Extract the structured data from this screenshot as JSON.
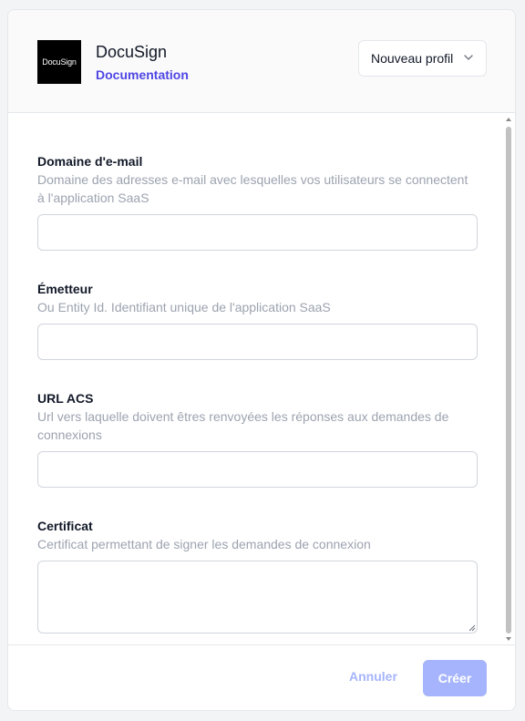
{
  "header": {
    "logo_text": "DocuSign",
    "app_name": "DocuSign",
    "doc_link": "Documentation",
    "profile_select": "Nouveau profil"
  },
  "fields": [
    {
      "label": "Domaine d'e-mail",
      "description": "Domaine des adresses e-mail avec lesquelles vos utilisateurs se connectent à l'application SaaS",
      "value": ""
    },
    {
      "label": "Émetteur",
      "description": "Ou Entity Id. Identifiant unique de l'application SaaS",
      "value": ""
    },
    {
      "label": "URL ACS",
      "description": "Url vers laquelle doivent êtres renvoyées les réponses aux demandes de connexions",
      "value": ""
    },
    {
      "label": "Certificat",
      "description": "Certificat permettant de signer les demandes de connexion",
      "value": ""
    }
  ],
  "footer": {
    "cancel_label": "Annuler",
    "create_label": "Créer"
  },
  "colors": {
    "accent": "#4f46e5",
    "button_disabled": "#a5b4fc",
    "muted_text": "#9ca3af"
  },
  "icons": {
    "profile_dropdown": "chevron-down-icon",
    "scroll_up": "arrow-up-icon",
    "scroll_down": "arrow-down-icon",
    "textarea_resize": "resize-grip-icon"
  }
}
